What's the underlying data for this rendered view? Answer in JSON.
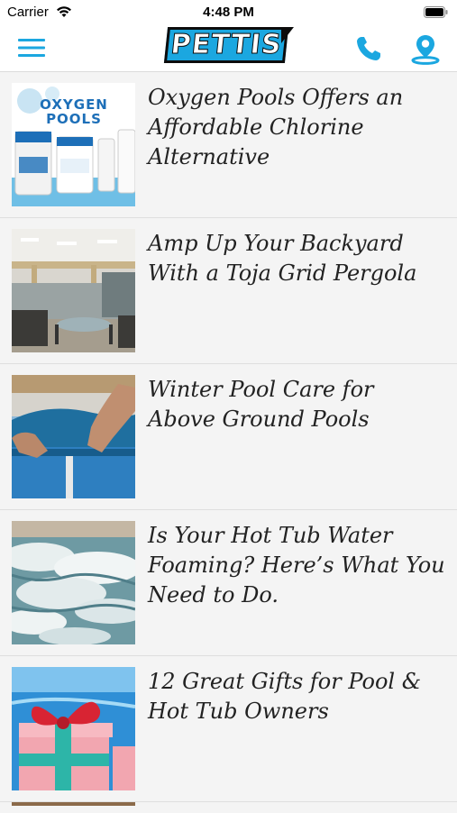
{
  "status_bar": {
    "carrier": "Carrier",
    "time": "4:48 PM",
    "wifi_icon": "wifi-icon",
    "battery_icon": "battery-icon"
  },
  "header": {
    "logo_text": "PETTIS",
    "menu_icon": "hamburger-menu-icon",
    "phone_icon": "phone-icon",
    "location_icon": "map-pin-icon",
    "accent_color": "#1ba7e0"
  },
  "articles": [
    {
      "title": "Oxygen Pools Offers an Affordable Chlorine Alternative",
      "image_label": "OXYGEN POOLS",
      "image_icon": "product-photo-icon"
    },
    {
      "title": "Amp Up Your Backyard With a Toja Grid Pergola",
      "image_icon": "pergola-photo-icon"
    },
    {
      "title": "Winter Pool Care for Above Ground Pools",
      "image_icon": "pool-cover-photo-icon"
    },
    {
      "title": "Is Your Hot Tub Water Foaming? Here’s What You Need to Do.",
      "image_icon": "foam-water-photo-icon"
    },
    {
      "title": "12 Great Gifts for Pool & Hot Tub Owners",
      "image_icon": "gift-box-photo-icon"
    }
  ]
}
